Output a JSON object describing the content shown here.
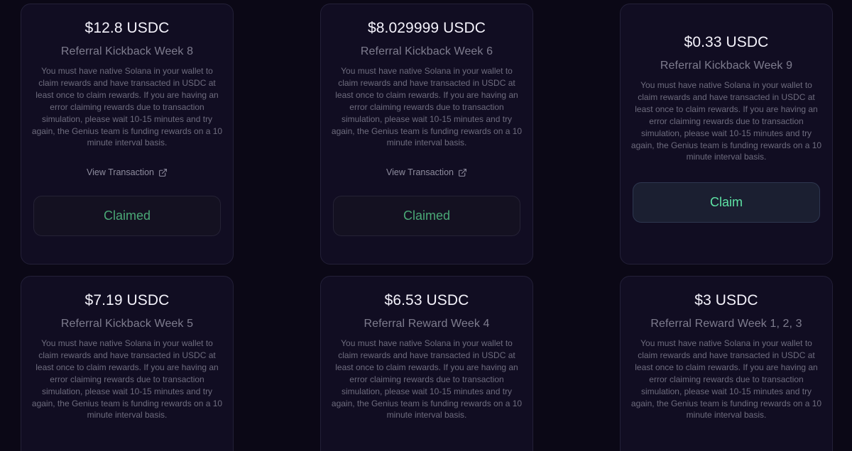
{
  "description": "You must have native Solana in your wallet to claim rewards and have transacted in USDC at least once to claim rewards. If you are having an error claiming rewards due to transaction simulation, please wait 10-15 minutes and try again, the Genius team is funding rewards on a 10 minute interval basis.",
  "view_transaction_label": "View Transaction",
  "claimed_label": "Claimed",
  "claim_label": "Claim",
  "rewards": [
    {
      "amount": "$12.8 USDC",
      "title": "Referral Kickback Week 8",
      "status": "claimed"
    },
    {
      "amount": "$8.029999 USDC",
      "title": "Referral Kickback Week 6",
      "status": "claimed"
    },
    {
      "amount": "$0.33 USDC",
      "title": "Referral Kickback Week 9",
      "status": "claimable"
    },
    {
      "amount": "$7.19 USDC",
      "title": "Referral Kickback Week 5",
      "status": "unknown"
    },
    {
      "amount": "$6.53 USDC",
      "title": "Referral Reward Week 4",
      "status": "unknown"
    },
    {
      "amount": "$3 USDC",
      "title": "Referral Reward Week 1, 2, 3",
      "status": "unknown"
    }
  ],
  "colors": {
    "background": "#0b0816",
    "card": "#110d22",
    "claimed_text": "#4aa876",
    "claim_text": "#5ee3a5"
  },
  "icons": {
    "external_link": "external-link-icon"
  }
}
